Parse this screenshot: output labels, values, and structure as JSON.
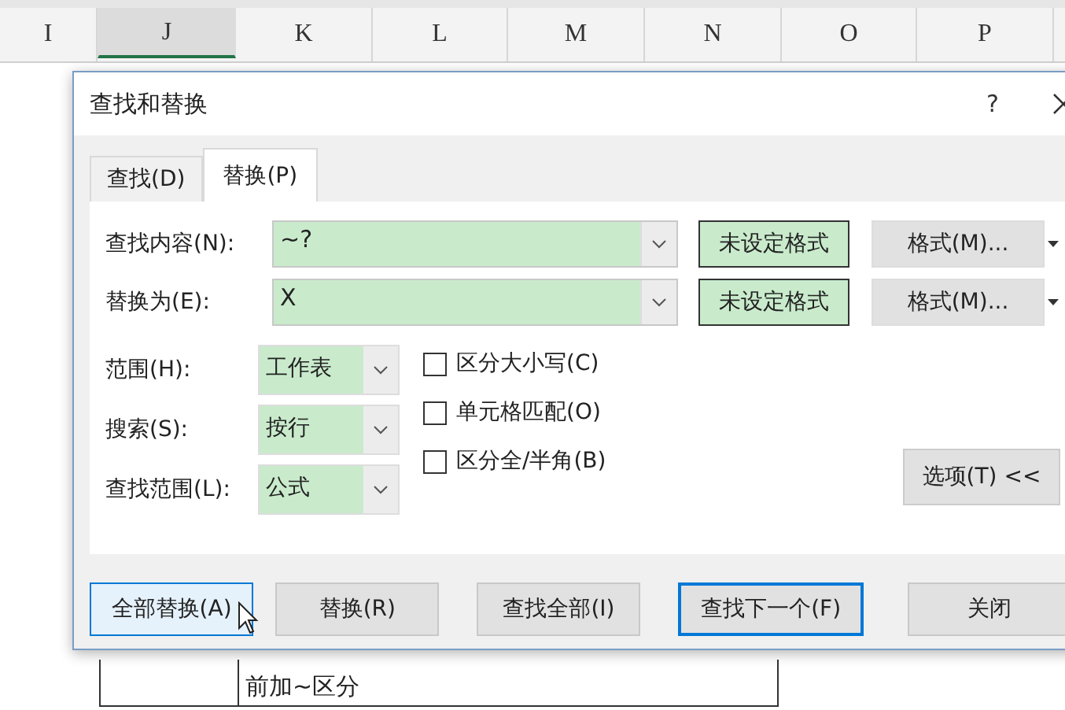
{
  "sheet": {
    "columns": [
      {
        "label": "I",
        "selected": false
      },
      {
        "label": "J",
        "selected": true
      },
      {
        "label": "K",
        "selected": false
      },
      {
        "label": "L",
        "selected": false
      },
      {
        "label": "M",
        "selected": false
      },
      {
        "label": "N",
        "selected": false
      },
      {
        "label": "O",
        "selected": false
      },
      {
        "label": "P",
        "selected": false
      }
    ],
    "cell_text": "前加~区分"
  },
  "dialog": {
    "title": "查找和替换",
    "help": "?",
    "tabs": [
      {
        "label": "查找(D)",
        "selected": false
      },
      {
        "label": "替换(P)",
        "selected": true
      }
    ],
    "fields": [
      {
        "label": "查找内容(N):",
        "value": "~?",
        "format_status": "未设定格式",
        "format_button": "格式(M)..."
      },
      {
        "label": "替换为(E):",
        "value": "X",
        "format_status": "未设定格式",
        "format_button": "格式(M)..."
      }
    ],
    "selects": [
      {
        "label": "范围(H):",
        "value": "工作表"
      },
      {
        "label": "搜索(S):",
        "value": "按行"
      },
      {
        "label": "查找范围(L):",
        "value": "公式"
      }
    ],
    "checkboxes": [
      {
        "label": "区分大小写(C)",
        "checked": false
      },
      {
        "label": "单元格匹配(O)",
        "checked": false
      },
      {
        "label": "区分全/半角(B)",
        "checked": false
      }
    ],
    "options_button": "选项(T) <<",
    "buttons": [
      {
        "label": "全部替换(A)",
        "kind": "hover"
      },
      {
        "label": "替换(R)",
        "kind": "normal"
      },
      {
        "label": "查找全部(I)",
        "kind": "normal"
      },
      {
        "label": "查找下一个(F)",
        "kind": "default"
      },
      {
        "label": "关闭",
        "kind": "normal"
      }
    ]
  }
}
